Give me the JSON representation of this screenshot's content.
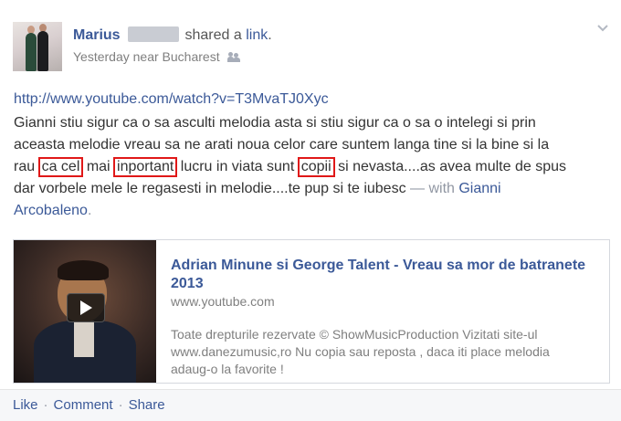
{
  "post": {
    "author": {
      "name": "Marius",
      "action_text": "shared a",
      "action_link": "link",
      "action_end": "."
    },
    "meta": {
      "time": "Yesterday near Bucharest",
      "audience_icon": "friends-icon"
    },
    "url": "http://www.youtube.com/watch?v=T3MvaTJ0Xyc",
    "body": {
      "line1": "Gianni stiu sigur ca o sa asculti melodia asta si stiu sigur ca o sa o intelegi si prin",
      "line2": "aceasta melodie vreau sa ne arati noua celor care suntem langa tine si la bine si la",
      "line3_a": "rau ",
      "line3_box1": "ca cel",
      "line3_b": " mai ",
      "line3_box2": "inportant",
      "line3_c": " lucru in viata sunt ",
      "line3_box3": "copii",
      "line3_d": " si nevasta....as avea multe de spus",
      "line4": "dar vorbele mele le regasesti in melodie....te pup si te iubesc",
      "with_sep": " — with ",
      "with_name_1": "Gianni",
      "with_name_2": "Arcobaleno",
      "with_end": "."
    },
    "attachment": {
      "title": "Adrian Minune si George Talent - Vreau sa mor de batranete 2013",
      "domain": "www.youtube.com",
      "description": "Toate drepturile rezervate © ShowMusicProduction Vizitati site-ul www.danezumusic,ro Nu copia sau reposta , daca iti place melodia adaug-o la favorite !"
    },
    "actions": {
      "like": "Like",
      "comment": "Comment",
      "share": "Share",
      "separator": "·"
    }
  },
  "colors": {
    "link": "#3b5998",
    "text": "#333333",
    "muted": "#7f7f7f",
    "highlight_box": "#e01818"
  }
}
